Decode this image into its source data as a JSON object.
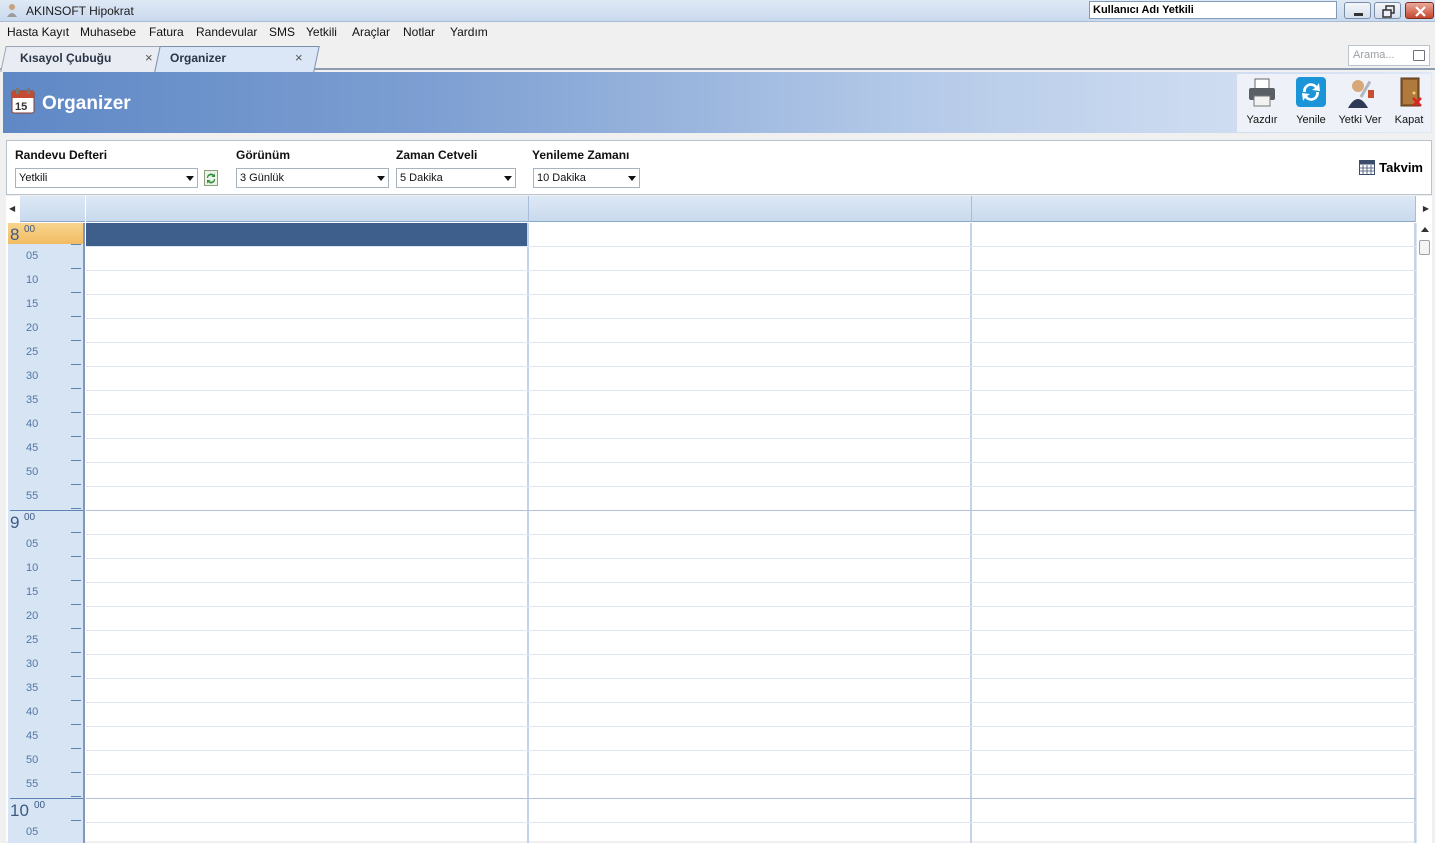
{
  "window": {
    "title": "AKINSOFT Hipokrat",
    "user": "Kullanıcı Adı Yetkili"
  },
  "menu": [
    "Hasta Kayıt",
    "Muhasebe",
    "Fatura",
    "Randevular",
    "SMS",
    "Yetkili",
    "Araçlar",
    "Notlar",
    "Yardım"
  ],
  "tabs": [
    {
      "label": "Kısayol Çubuğu",
      "close": "×"
    },
    {
      "label": "Organizer",
      "close": "×"
    }
  ],
  "search": {
    "placeholder": "Arama..."
  },
  "header": {
    "title": "Organizer"
  },
  "toolbar": {
    "print": "Yazdır",
    "refresh": "Yenile",
    "authorize": "Yetki Ver",
    "close": "Kapat"
  },
  "filters": {
    "book": {
      "label": "Randevu Defteri",
      "value": "Yetkili"
    },
    "view": {
      "label": "Görünüm",
      "value": "3 Günlük"
    },
    "scale": {
      "label": "Zaman Cetveli",
      "value": "5 Dakika"
    },
    "refresh_time": {
      "label": "Yenileme Zamanı",
      "value": "10 Dakika"
    },
    "calendar": "Takvim"
  },
  "schedule": {
    "hours": [
      {
        "hour": "8",
        "sup": "00",
        "minutes": [
          "05",
          "10",
          "15",
          "20",
          "25",
          "30",
          "35",
          "40",
          "45",
          "50",
          "55"
        ]
      },
      {
        "hour": "9",
        "sup": "00",
        "minutes": [
          "05",
          "10",
          "15",
          "20",
          "25",
          "30",
          "35",
          "40",
          "45",
          "50",
          "55"
        ]
      },
      {
        "hour": "10",
        "sup": "00",
        "minutes": [
          "05"
        ]
      }
    ]
  },
  "colors": {
    "accent": "#3e5f8c",
    "current_hour": "#f1bc62",
    "time_column": "#d6e4f3"
  }
}
